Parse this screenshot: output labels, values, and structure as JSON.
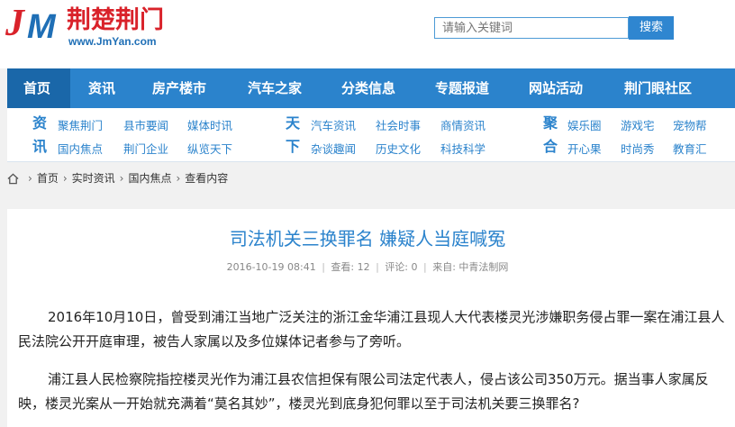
{
  "logo": {
    "j": "J",
    "m": "M",
    "name_cn": "荆楚荆门",
    "url": "www.JmYan.com"
  },
  "search": {
    "placeholder": "请输入关键词",
    "button": "搜索"
  },
  "nav": [
    {
      "label": "首页"
    },
    {
      "label": "资讯"
    },
    {
      "label": "房产楼市"
    },
    {
      "label": "汽车之家"
    },
    {
      "label": "分类信息"
    },
    {
      "label": "专题报道"
    },
    {
      "label": "网站活动"
    },
    {
      "label": "荆门眼社区"
    }
  ],
  "subnav": {
    "groups": [
      {
        "label_top": "资",
        "label_bottom": "讯",
        "links": [
          "聚焦荆门",
          "县市要闻",
          "媒体时讯",
          "国内焦点",
          "荆门企业",
          "纵览天下"
        ]
      },
      {
        "label_top": "天",
        "label_bottom": "下",
        "links": [
          "汽车资讯",
          "社会时事",
          "商情资讯",
          "杂谈趣闻",
          "历史文化",
          "科技科学"
        ]
      },
      {
        "label_top": "聚",
        "label_bottom": "合",
        "links": [
          "娱乐圈",
          "游戏宅",
          "宠物帮",
          "开心果",
          "时尚秀",
          "教育汇"
        ]
      }
    ]
  },
  "breadcrumb": [
    "首页",
    "实时资讯",
    "国内焦点",
    "查看内容"
  ],
  "article": {
    "title": "司法机关三换罪名 嫌疑人当庭喊冤",
    "date": "2016-10-19 08:41",
    "views": "查看: 12",
    "comments": "评论: 0",
    "source": "来自: 中青法制网",
    "paragraphs": [
      "2016年10月10日，曾受到浦江当地广泛关注的浙江金华浦江县现人大代表楼灵光涉嫌职务侵占罪一案在浦江县人民法院公开开庭审理，被告人家属以及多位媒体记者参与了旁听。",
      "浦江县人民检察院指控楼灵光作为浦江县农信担保有限公司法定代表人，侵占该公司350万元。据当事人家属反映，楼灵光案从一开始就充满着“莫名其妙”，楼灵光到底身犯何罪以至于司法机关要三换罪名?"
    ]
  },
  "colors": {
    "brand_blue": "#2b83cc",
    "active_nav": "#1a67a9",
    "brand_red": "#d9222a"
  }
}
